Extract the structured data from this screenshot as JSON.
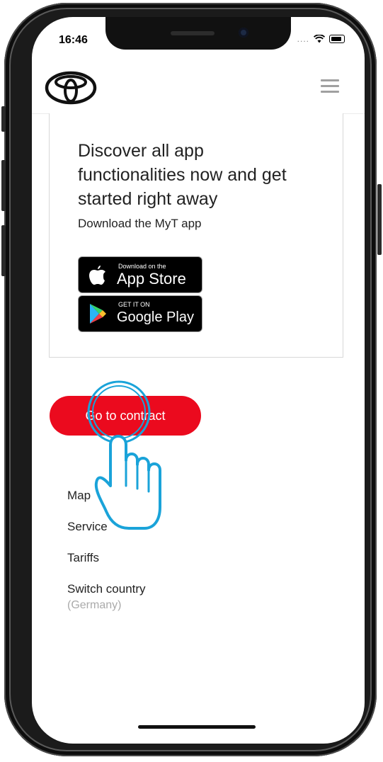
{
  "status_bar": {
    "time": "16:46",
    "signal": "....",
    "wifi_icon": "wifi-icon",
    "battery_icon": "battery-icon"
  },
  "header": {
    "logo_icon": "toyota-logo",
    "menu_icon": "hamburger-menu-icon"
  },
  "promo": {
    "title": "Discover all app functionalities now and get started right away",
    "subtitle": "Download the MyT app",
    "app_store": {
      "small": "Download on the",
      "big": "App Store"
    },
    "google_play": {
      "small": "GET IT ON",
      "big": "Google Play"
    }
  },
  "cta": {
    "label": "Go to contract",
    "color": "#eb0a1e"
  },
  "nav_links": [
    {
      "label": "Map"
    },
    {
      "label": "Service"
    },
    {
      "label": "Tariffs"
    },
    {
      "label": "Switch country",
      "sub": "(Germany)"
    }
  ],
  "overlay": {
    "gesture_icon": "tap-hand-icon",
    "accent": "#1aa3d9"
  }
}
